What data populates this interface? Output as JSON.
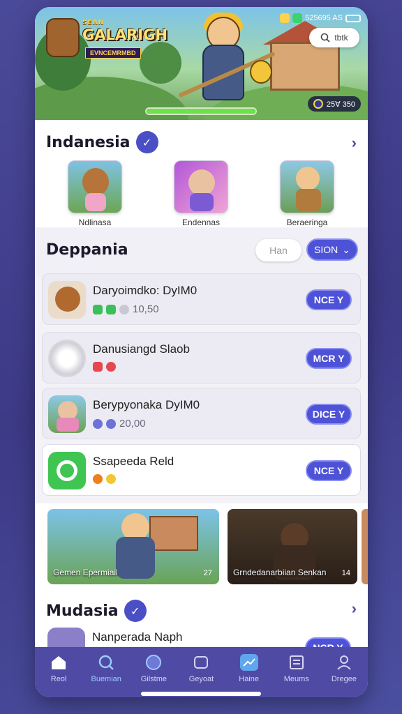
{
  "banner": {
    "logo_top": "SEAN",
    "logo_title": "GALARIGH",
    "logo_sub": "EVNCEMRMBD",
    "status_text": "525695 AS",
    "search_label": "tbtk",
    "coins": "25Ɐ 350",
    "progress": 1.0
  },
  "section1": {
    "title": "Indanesia",
    "apps": [
      {
        "label": "Ndlinasa"
      },
      {
        "label": "Endennas"
      },
      {
        "label": "Beraeringa"
      }
    ]
  },
  "section2": {
    "title": "Deppania",
    "btn_light": "Han",
    "btn_dark": "SION",
    "rows": [
      {
        "name": "Daryoimdko: DyIM0",
        "meta": "10,50",
        "action": "NCE Y"
      },
      {
        "name": "Danusiangd Slaob",
        "meta": "",
        "action": "MCR Y"
      },
      {
        "name": "Berypyonaka DyIM0",
        "meta": "20,00",
        "action": "DICE Y"
      },
      {
        "name": "Ssapeeda Reld",
        "meta": "",
        "action": "NCE Y"
      }
    ],
    "features": [
      {
        "caption": "Gemen Epermiail",
        "count": "27"
      },
      {
        "caption": "Grndedanarbiian Senkan",
        "count": "14"
      }
    ]
  },
  "section3": {
    "title": "Mudasia",
    "row_name": "Nanperada Naph",
    "row_action": "NCR Y"
  },
  "nav": [
    {
      "label": "Reol"
    },
    {
      "label": "Buemian"
    },
    {
      "label": "Gilstme"
    },
    {
      "label": "Geyoat"
    },
    {
      "label": "Haine"
    },
    {
      "label": "Meums"
    },
    {
      "label": "Dregee"
    }
  ],
  "colors": {
    "accent": "#4d52d6",
    "nav_bg": "#4f4ba5",
    "progress": "#6de04e"
  }
}
